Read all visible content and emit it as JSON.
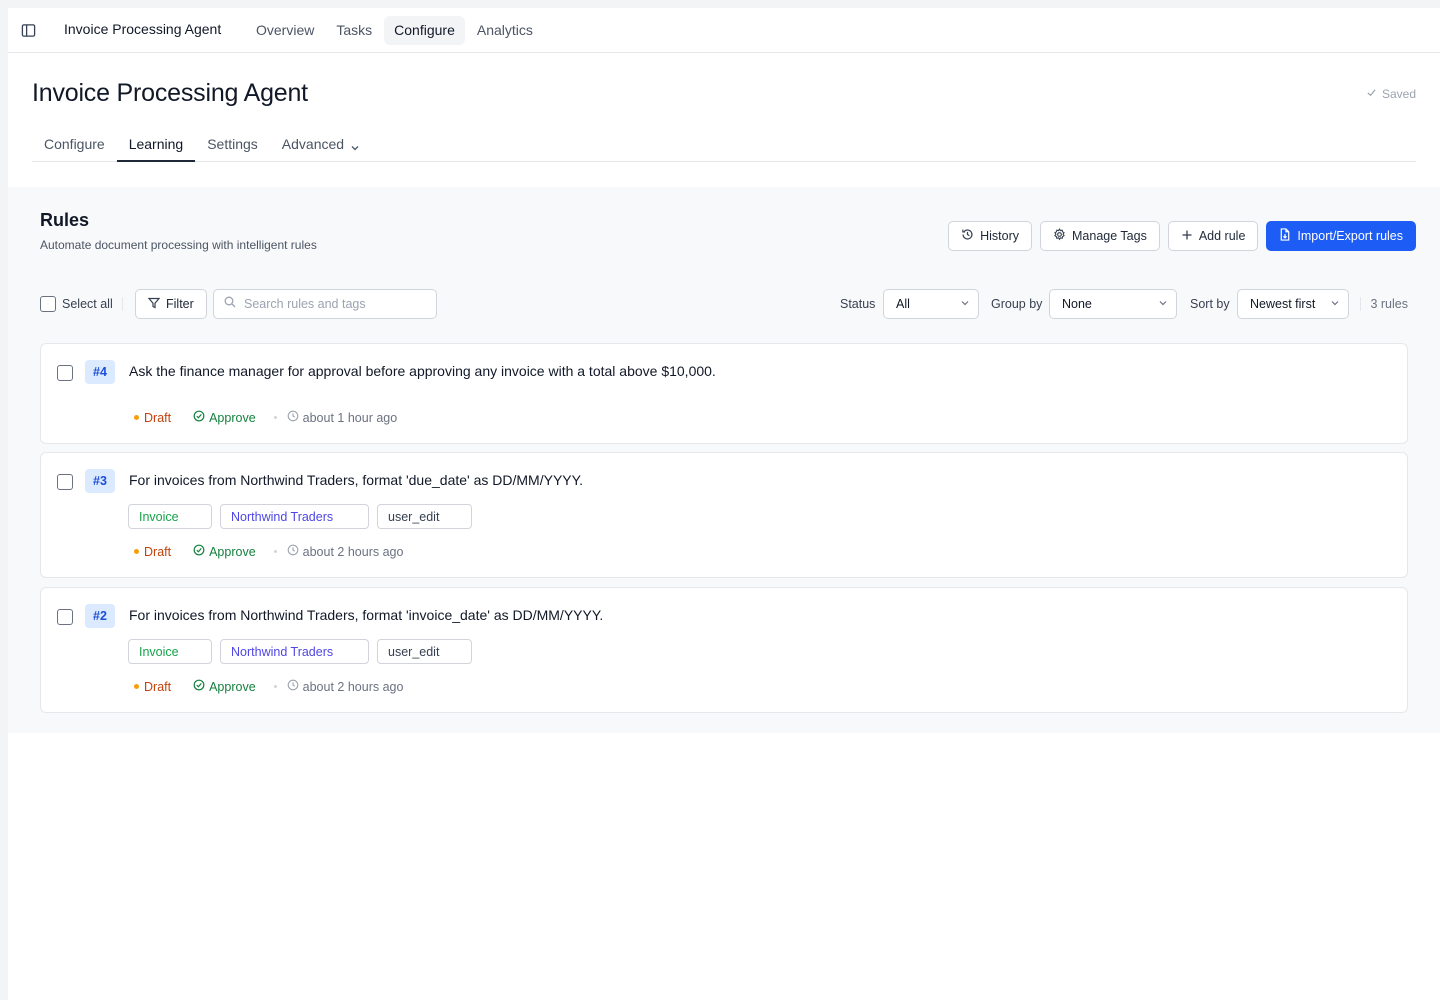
{
  "app": {
    "title": "Invoice Processing Agent"
  },
  "topnav": {
    "tabs": [
      {
        "label": "Overview",
        "active": false
      },
      {
        "label": "Tasks",
        "active": false
      },
      {
        "label": "Configure",
        "active": true
      },
      {
        "label": "Analytics",
        "active": false
      }
    ]
  },
  "page": {
    "title": "Invoice Processing Agent",
    "saved_label": "Saved"
  },
  "subtabs": [
    {
      "label": "Configure",
      "active": false
    },
    {
      "label": "Learning",
      "active": true
    },
    {
      "label": "Settings",
      "active": false
    },
    {
      "label": "Advanced",
      "active": false
    }
  ],
  "rules_section": {
    "title": "Rules",
    "subtitle": "Automate document processing with intelligent rules",
    "buttons": {
      "history": "History",
      "manage_tags": "Manage Tags",
      "add_rule": "Add rule",
      "import_export": "Import/Export rules"
    }
  },
  "filters": {
    "select_all": "Select all",
    "filter_label": "Filter",
    "search_placeholder": "Search rules and tags",
    "status_label": "Status",
    "status_value": "All",
    "group_label": "Group by",
    "group_value": "None",
    "sort_label": "Sort by",
    "sort_value": "Newest first",
    "count": "3 rules"
  },
  "rules": [
    {
      "id": "#4",
      "text": "Ask the finance manager for approval before approving any invoice with a total above $10,000.",
      "tags": [],
      "status": "Draft",
      "action": "Approve",
      "time": "about 1 hour ago"
    },
    {
      "id": "#3",
      "text": "For invoices from Northwind Traders, format 'due_date' as DD/MM/YYYY.",
      "tags": [
        "Invoice",
        "Northwind Traders",
        "user_edit"
      ],
      "status": "Draft",
      "action": "Approve",
      "time": "about 2 hours ago"
    },
    {
      "id": "#2",
      "text": "For invoices from Northwind Traders, format 'invoice_date' as DD/MM/YYYY.",
      "tags": [
        "Invoice",
        "Northwind Traders",
        "user_edit"
      ],
      "status": "Draft",
      "action": "Approve",
      "time": "about 2 hours ago"
    }
  ],
  "colors": {
    "primary": "#1d5cf5",
    "draft": "#c2410c",
    "approve": "#15803d",
    "tag_invoice": "#16a34a",
    "tag_company": "#4f46e5"
  }
}
